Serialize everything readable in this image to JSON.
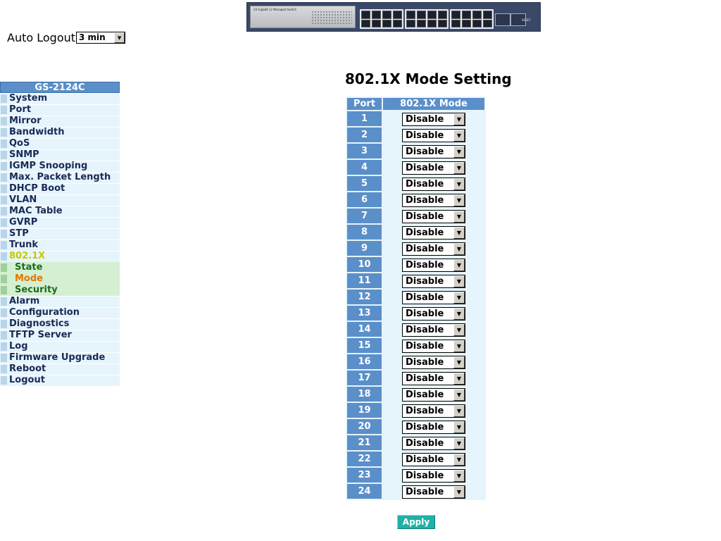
{
  "banner": {
    "device_label": "24 Gigabit L2 Managed Switch",
    "reset_label": "RESET"
  },
  "auto_logout": {
    "label": "Auto Logout",
    "selected": "3 min"
  },
  "sidebar": {
    "model": "GS-2124C",
    "items": [
      {
        "label": "System"
      },
      {
        "label": "Port"
      },
      {
        "label": "Mirror"
      },
      {
        "label": "Bandwidth"
      },
      {
        "label": "QoS"
      },
      {
        "label": "SNMP"
      },
      {
        "label": "IGMP Snooping"
      },
      {
        "label": "Max. Packet Length"
      },
      {
        "label": "DHCP Boot"
      },
      {
        "label": "VLAN"
      },
      {
        "label": "MAC Table"
      },
      {
        "label": "GVRP"
      },
      {
        "label": "STP"
      },
      {
        "label": "Trunk"
      },
      {
        "label": "802.1X"
      },
      {
        "label": "State"
      },
      {
        "label": "Mode"
      },
      {
        "label": "Security"
      },
      {
        "label": "Alarm"
      },
      {
        "label": "Configuration"
      },
      {
        "label": "Diagnostics"
      },
      {
        "label": "TFTP Server"
      },
      {
        "label": "Log"
      },
      {
        "label": "Firmware Upgrade"
      },
      {
        "label": "Reboot"
      },
      {
        "label": "Logout"
      }
    ]
  },
  "main": {
    "title": "802.1X Mode Setting",
    "columns": [
      "Port",
      "802.1X Mode"
    ],
    "rows": [
      {
        "port": "1",
        "mode": "Disable"
      },
      {
        "port": "2",
        "mode": "Disable"
      },
      {
        "port": "3",
        "mode": "Disable"
      },
      {
        "port": "4",
        "mode": "Disable"
      },
      {
        "port": "5",
        "mode": "Disable"
      },
      {
        "port": "6",
        "mode": "Disable"
      },
      {
        "port": "7",
        "mode": "Disable"
      },
      {
        "port": "8",
        "mode": "Disable"
      },
      {
        "port": "9",
        "mode": "Disable"
      },
      {
        "port": "10",
        "mode": "Disable"
      },
      {
        "port": "11",
        "mode": "Disable"
      },
      {
        "port": "12",
        "mode": "Disable"
      },
      {
        "port": "13",
        "mode": "Disable"
      },
      {
        "port": "14",
        "mode": "Disable"
      },
      {
        "port": "15",
        "mode": "Disable"
      },
      {
        "port": "16",
        "mode": "Disable"
      },
      {
        "port": "17",
        "mode": "Disable"
      },
      {
        "port": "18",
        "mode": "Disable"
      },
      {
        "port": "19",
        "mode": "Disable"
      },
      {
        "port": "20",
        "mode": "Disable"
      },
      {
        "port": "21",
        "mode": "Disable"
      },
      {
        "port": "22",
        "mode": "Disable"
      },
      {
        "port": "23",
        "mode": "Disable"
      },
      {
        "port": "24",
        "mode": "Disable"
      }
    ],
    "apply_label": "Apply"
  },
  "colors": {
    "header_blue": "#5b8fc9",
    "row_bg": "#e6f4fc",
    "apply": "#1fb0a6",
    "submenu_bg": "#d4efd2",
    "current_sub": "#e07800"
  },
  "icons": [
    "chevron-down-icon",
    "menu-bullet-icon"
  ]
}
